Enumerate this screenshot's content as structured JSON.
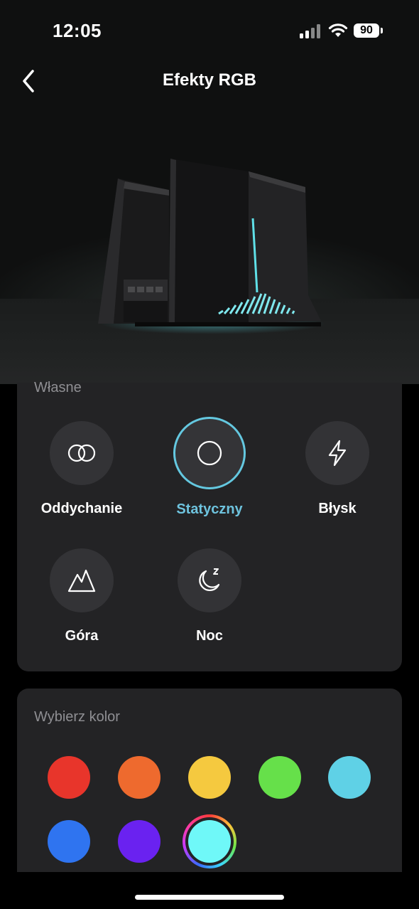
{
  "status": {
    "time": "12:05",
    "battery": "90"
  },
  "header": {
    "title": "Efekty RGB"
  },
  "effects": {
    "section_label": "Własne",
    "items": [
      {
        "label": "Oddychanie",
        "icon": "breathing-icon",
        "selected": false
      },
      {
        "label": "Statyczny",
        "icon": "static-icon",
        "selected": true
      },
      {
        "label": "Błysk",
        "icon": "flash-icon",
        "selected": false
      },
      {
        "label": "Góra",
        "icon": "mountain-icon",
        "selected": false
      },
      {
        "label": "Noc",
        "icon": "night-icon",
        "selected": false
      }
    ]
  },
  "colors": {
    "section_label": "Wybierz kolor",
    "swatches": [
      {
        "color": "#e8352b",
        "selected": false
      },
      {
        "color": "#ee6a2e",
        "selected": false
      },
      {
        "color": "#f5c93f",
        "selected": false
      },
      {
        "color": "#66e04a",
        "selected": false
      },
      {
        "color": "#5fd1e6",
        "selected": false
      },
      {
        "color": "#2f74f0",
        "selected": false
      },
      {
        "color": "#6a22f0",
        "selected": false
      },
      {
        "color": "#6ff8f8",
        "selected": true
      }
    ]
  },
  "accent_color": "#6ec3de"
}
